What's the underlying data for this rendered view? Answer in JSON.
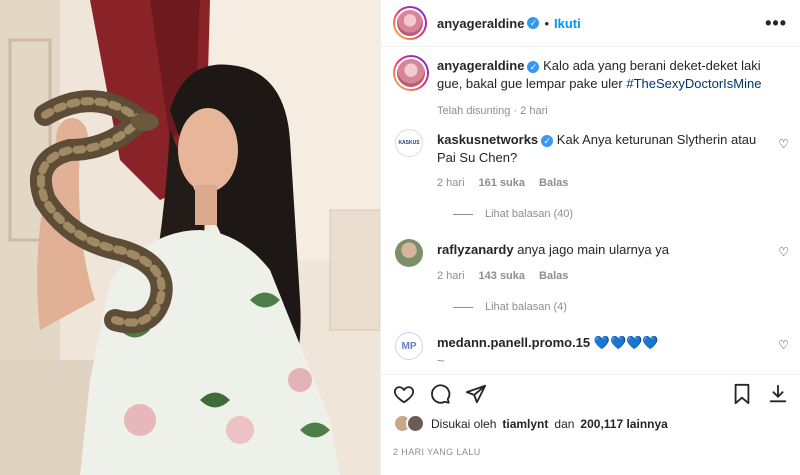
{
  "post": {
    "username": "anyageraldine",
    "follow_label": "Ikuti",
    "more_label": "•••"
  },
  "caption": {
    "username": "anyageraldine",
    "text": "Kalo ada yang berani deket-deket laki gue, bakal gue lempar pake uler",
    "hashtag": "#TheSexyDoctorIsMine",
    "meta": "Telah disunting · 2 hari"
  },
  "comments": [
    {
      "username": "kaskusnetworks",
      "avatar_text": "KASKUS",
      "text": "Kak Anya keturunan Slytherin atau Pai Su Chen?",
      "time": "2 hari",
      "likes": "161 suka",
      "reply": "Balas",
      "view_replies": "Lihat balasan (40)"
    },
    {
      "username": "raflyzanardy",
      "text": "anya jago main ularnya ya",
      "time": "2 hari",
      "likes": "143 suka",
      "reply": "Balas",
      "view_replies": "Lihat balasan (4)"
    },
    {
      "username": "medann.panell.promo.15",
      "avatar_text": "MP",
      "text": "💙💙💙💙",
      "extra": "~"
    }
  ],
  "likes_summary": {
    "prefix": "Disukai oleh",
    "user": "tiamlynt",
    "middle": "dan",
    "count": "200,117 lainnya"
  },
  "timestamp": "2 HARI YANG LALU",
  "colors": {
    "link": "#0095f6",
    "verified": "#3897f0",
    "hashtag": "#00376b"
  }
}
